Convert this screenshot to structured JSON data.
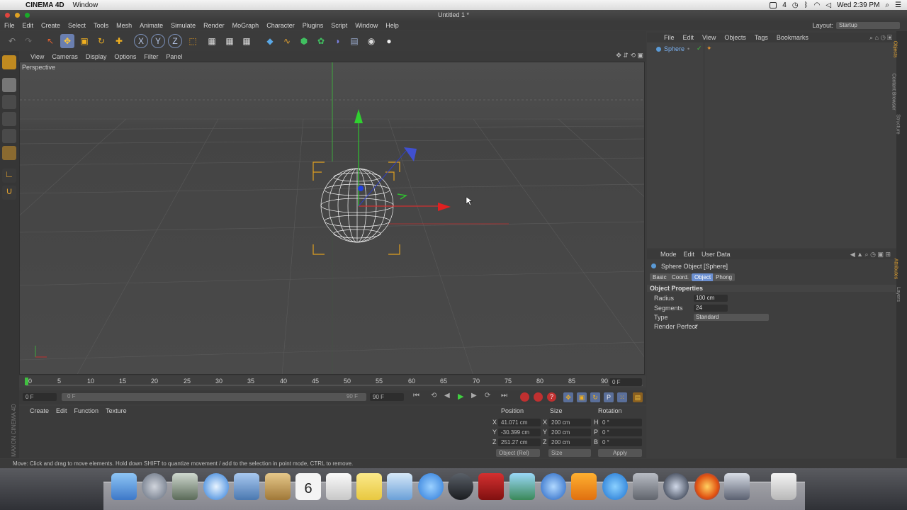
{
  "mac_menubar": {
    "app": "CINEMA 4D",
    "menus": [
      "Window"
    ],
    "battery": "4",
    "clock": "Wed 2:39 PM"
  },
  "window": {
    "title": "Untitled 1 *"
  },
  "main_menu": [
    "File",
    "Edit",
    "Create",
    "Select",
    "Tools",
    "Mesh",
    "Animate",
    "Simulate",
    "Render",
    "MoGraph",
    "Character",
    "Plugins",
    "Script",
    "Window",
    "Help"
  ],
  "layout": {
    "label": "Layout:",
    "value": "Startup"
  },
  "viewport": {
    "menu": [
      "View",
      "Cameras",
      "Display",
      "Options",
      "Filter",
      "Panel"
    ],
    "label": "Perspective"
  },
  "timeline": {
    "ticks": [
      "0",
      "5",
      "10",
      "15",
      "20",
      "25",
      "30",
      "35",
      "40",
      "45",
      "50",
      "55",
      "60",
      "65",
      "70",
      "75",
      "80",
      "85",
      "90"
    ],
    "current_frame": "0 F",
    "start": "0 F",
    "end_inner": "90 F",
    "end": "90 F",
    "range_start": "0 F"
  },
  "material_manager": {
    "menu": [
      "Create",
      "Edit",
      "Function",
      "Texture"
    ]
  },
  "coordinates": {
    "headers": [
      "Position",
      "Size",
      "Rotation"
    ],
    "rows": [
      {
        "axis": "X",
        "pos": "41.071 cm",
        "size_axis": "X",
        "size": "200 cm",
        "rot_axis": "H",
        "rot": "0 °"
      },
      {
        "axis": "Y",
        "pos": "-30.399 cm",
        "size_axis": "Y",
        "size": "200 cm",
        "rot_axis": "P",
        "rot": "0 °"
      },
      {
        "axis": "Z",
        "pos": "251.27 cm",
        "size_axis": "Z",
        "size": "200 cm",
        "rot_axis": "B",
        "rot": "0 °"
      }
    ],
    "mode": "Object (Rel)",
    "size_mode": "Size",
    "apply": "Apply"
  },
  "object_manager": {
    "menu": [
      "File",
      "Edit",
      "View",
      "Objects",
      "Tags",
      "Bookmarks"
    ],
    "objects": [
      "Sphere"
    ]
  },
  "attributes": {
    "menu": [
      "Mode",
      "Edit",
      "User Data"
    ],
    "title": "Sphere Object [Sphere]",
    "tabs": [
      "Basic",
      "Coord.",
      "Object",
      "Phong"
    ],
    "active_tab": "Object",
    "section": "Object Properties",
    "props": [
      {
        "label": "Radius",
        "value": "100 cm"
      },
      {
        "label": "Segments",
        "value": "24"
      },
      {
        "label": "Type",
        "value": "Standard"
      },
      {
        "label": "Render Perfect",
        "value": "✓"
      }
    ]
  },
  "right_tabs": [
    "Objects",
    "Content Browser",
    "Structure"
  ],
  "attr_side_tabs": [
    "Attributes",
    "Layers"
  ],
  "maxon": "MAXON CINEMA 4D",
  "status": "Move: Click and drag to move elements. Hold down SHIFT to quantize movement / add to the selection in point mode, CTRL to remove.",
  "calendar_day": "6",
  "colors": {
    "accent": "#5a8ad6",
    "selected_tab": "#6b8fd0"
  }
}
